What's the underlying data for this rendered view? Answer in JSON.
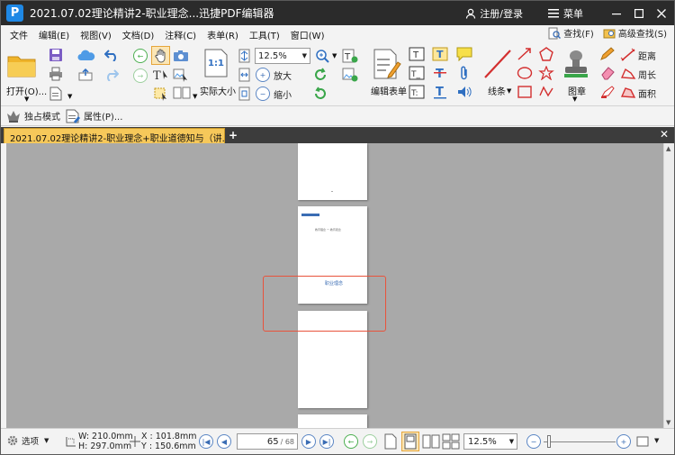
{
  "window": {
    "title": "2021.07.02理论精讲2-职业理念...迅捷PDF编辑器",
    "login_label": "注册/登录",
    "menu_label": "菜单"
  },
  "menubar": {
    "items": [
      "文件",
      "编辑(E)",
      "视图(V)",
      "文档(D)",
      "注释(C)",
      "表单(R)",
      "工具(T)",
      "窗口(W)"
    ],
    "find_label": "查找(F)",
    "advanced_find_label": "高级查找(S)"
  },
  "ribbon": {
    "open_label": "打开(O)...",
    "actual_size_label": "实际大小",
    "zoom_value": "12.5%",
    "zoom_in_label": "放大",
    "zoom_out_label": "缩小",
    "edit_form_label": "编辑表单",
    "line_label": "线条",
    "stamp_label": "图章",
    "distance_label": "距离",
    "perimeter_label": "周长",
    "area_label": "面积",
    "actual_size_icon_text": "1:1"
  },
  "subbar": {
    "exclusive_mode_label": "独占模式",
    "properties_label": "属性(P)..."
  },
  "tabs": {
    "document_tab_label": "2021.07.02理论精讲2-职业理念+职业道德知与（讲.. *"
  },
  "viewer": {
    "page_heading_text": "职业理念",
    "page_small_text": "教育理念 一·教育观念"
  },
  "status": {
    "options_label": "选项",
    "width_text": "W: 210.0mm",
    "height_text": "H: 297.0mm",
    "x_text": "X : 101.8mm",
    "y_text": "Y : 150.6mm",
    "current_page": "65",
    "total_pages": "/ 68",
    "zoom_value": "12.5%"
  },
  "colors": {
    "titlebar": "#2b2b2b",
    "tab_active": "#f6c85a",
    "viewer_bg": "#a9a9a9",
    "selection_rect": "#e8533c",
    "accent_blue": "#1e88e5"
  }
}
